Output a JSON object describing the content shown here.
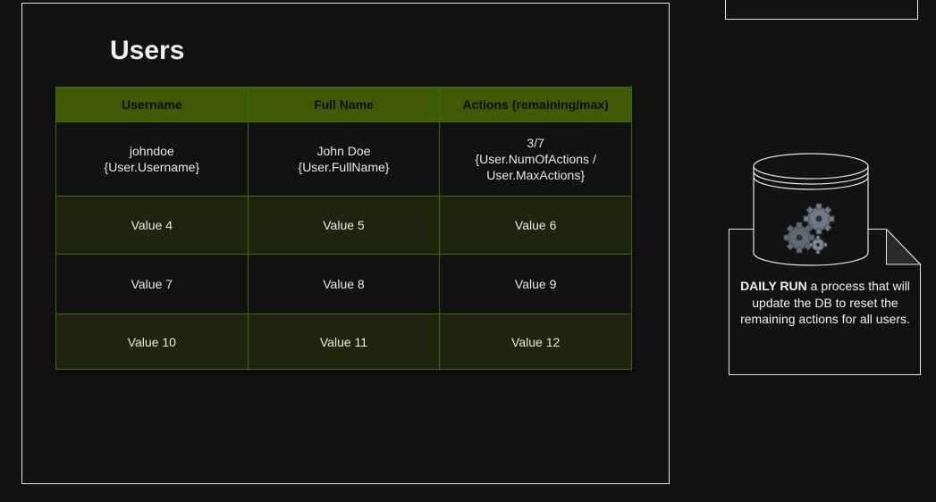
{
  "panel": {
    "title": "Users"
  },
  "table": {
    "headers": [
      "Username",
      "Full Name",
      "Actions (remaining/max)"
    ],
    "rows": [
      [
        "johndoe\n{User.Username}",
        "John Doe\n{User.FullName}",
        "3/7\n{User.NumOfActions /\nUser.MaxActions}"
      ],
      [
        "Value 4",
        "Value 5",
        "Value 6"
      ],
      [
        "Value 7",
        "Value 8",
        "Value 9"
      ],
      [
        "Value 10",
        "Value 11",
        "Value 12"
      ]
    ]
  },
  "daily_run": {
    "bold": "DAILY RUN",
    "text": " a process that will update the DB to reset the remaining actions for all users."
  },
  "colors": {
    "header_bg": "#3f5a03",
    "alt_row_bg": "#1f260d",
    "border": "#3a6b10"
  },
  "icons": [
    "database-icon",
    "gears-icon"
  ]
}
